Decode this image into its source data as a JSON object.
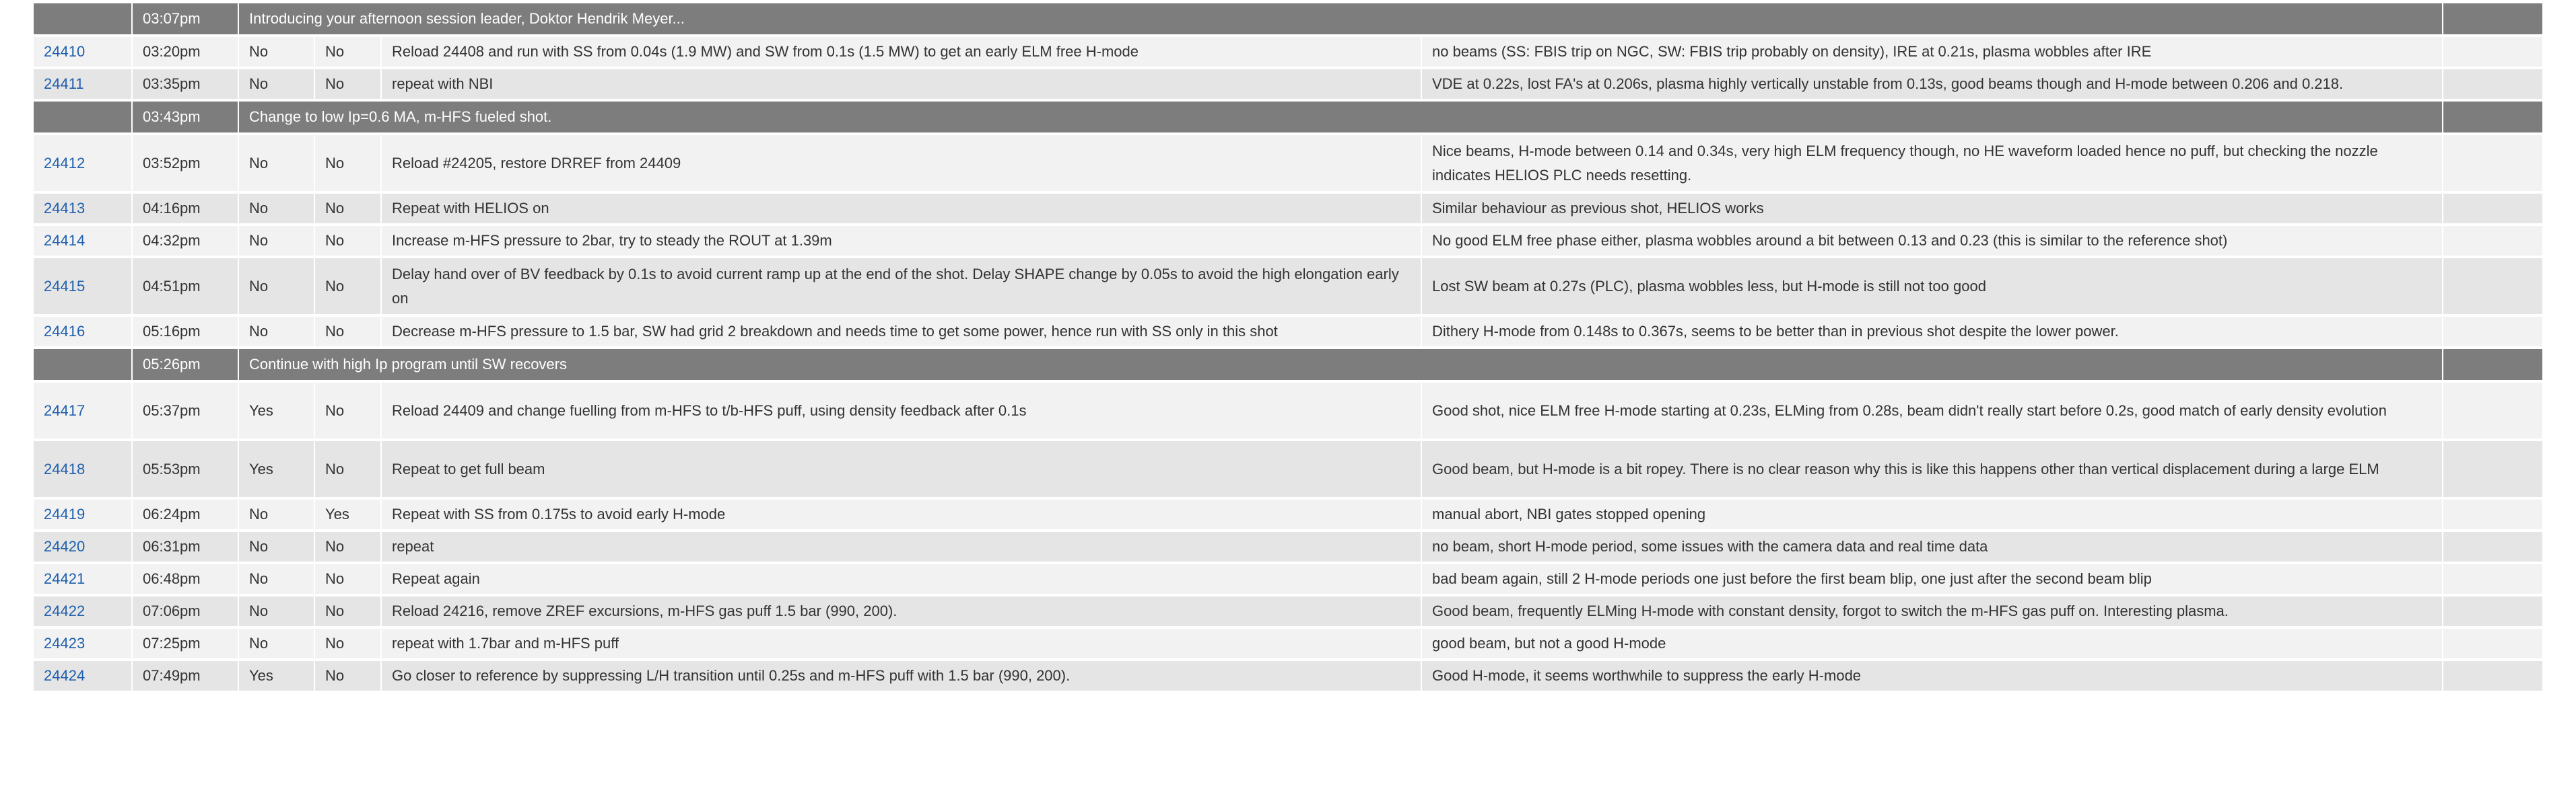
{
  "log": {
    "rows": [
      {
        "kind": "section",
        "time": "03:07pm",
        "text": "Introducing your afternoon session leader, Doktor Hendrik Meyer..."
      },
      {
        "kind": "shot",
        "shot": "24410",
        "time": "03:20pm",
        "col3": "No",
        "col4": "No",
        "description": "Reload 24408 and run with SS from 0.04s (1.9 MW) and SW from 0.1s (1.5 MW) to get an early ELM free H-mode",
        "result": "no beams (SS: FBIS trip on NGC, SW: FBIS trip probably on density), IRE at 0.21s, plasma wobbles after IRE"
      },
      {
        "kind": "shot",
        "shot": "24411",
        "time": "03:35pm",
        "col3": "No",
        "col4": "No",
        "description": "repeat with NBI",
        "result": "VDE at 0.22s, lost FA's at 0.206s, plasma highly vertically unstable from 0.13s, good beams though and H-mode between 0.206 and 0.218."
      },
      {
        "kind": "section",
        "time": "03:43pm",
        "text": "Change to low Ip=0.6 MA, m-HFS fueled shot."
      },
      {
        "kind": "shot",
        "shot": "24412",
        "time": "03:52pm",
        "col3": "No",
        "col4": "No",
        "description": "Reload #24205, restore DRREF from 24409",
        "result": "Nice beams, H-mode between 0.14 and 0.34s, very high ELM frequency though, no HE waveform loaded hence no puff, but checking the nozzle indicates HELIOS PLC needs resetting."
      },
      {
        "kind": "shot",
        "shot": "24413",
        "time": "04:16pm",
        "col3": "No",
        "col4": "No",
        "description": "Repeat with HELIOS on",
        "result": "Similar behaviour as previous shot, HELIOS works"
      },
      {
        "kind": "shot",
        "shot": "24414",
        "time": "04:32pm",
        "col3": "No",
        "col4": "No",
        "description": "Increase m-HFS pressure to 2bar, try to steady the ROUT at 1.39m",
        "result": "No good ELM free phase either, plasma wobbles around a bit between 0.13 and 0.23 (this is similar to the reference shot)"
      },
      {
        "kind": "shot",
        "shot": "24415",
        "time": "04:51pm",
        "col3": "No",
        "col4": "No",
        "description": "Delay hand over of BV feedback by 0.1s to avoid current ramp up at the end of the shot. Delay SHAPE change by 0.05s to avoid the high elongation early on",
        "result": "Lost SW beam at 0.27s (PLC), plasma wobbles less, but H-mode is still not too good"
      },
      {
        "kind": "shot",
        "shot": "24416",
        "time": "05:16pm",
        "col3": "No",
        "col4": "No",
        "description": "Decrease m-HFS pressure to 1.5 bar, SW had grid 2 breakdown and needs time to get some power, hence run with SS only in this shot",
        "result": "Dithery H-mode from 0.148s to 0.367s, seems to be better than in previous shot despite the lower power."
      },
      {
        "kind": "section",
        "time": "05:26pm",
        "text": "Continue with high Ip program until SW recovers"
      },
      {
        "kind": "shot",
        "shot": "24417",
        "time": "05:37pm",
        "col3": "Yes",
        "col4": "No",
        "description": "Reload 24409 and change fuelling from m-HFS to t/b-HFS puff, using density feedback after 0.1s",
        "result": "Good shot, nice ELM free H-mode starting at 0.23s, ELMing from 0.28s, beam didn't really start before 0.2s, good match of early density evolution"
      },
      {
        "kind": "shot",
        "shot": "24418",
        "time": "05:53pm",
        "col3": "Yes",
        "col4": "No",
        "description": "Repeat to get full beam",
        "result": "Good beam, but H-mode is a bit ropey. There is no clear reason why this is like this happens other than vertical displacement during a large ELM"
      },
      {
        "kind": "shot",
        "shot": "24419",
        "time": "06:24pm",
        "col3": "No",
        "col4": "Yes",
        "description": "Repeat with SS from 0.175s to avoid early H-mode",
        "result": "manual abort, NBI gates stopped opening"
      },
      {
        "kind": "shot",
        "shot": "24420",
        "time": "06:31pm",
        "col3": "No",
        "col4": "No",
        "description": "repeat",
        "result": "no beam, short H-mode period, some issues with the camera data and real time data"
      },
      {
        "kind": "shot",
        "shot": "24421",
        "time": "06:48pm",
        "col3": "No",
        "col4": "No",
        "description": "Repeat again",
        "result": "bad beam again, still 2 H-mode periods one just before the first beam blip, one just after the second beam blip"
      },
      {
        "kind": "shot",
        "shot": "24422",
        "time": "07:06pm",
        "col3": "No",
        "col4": "No",
        "description": "Reload 24216, remove ZREF excursions, m-HFS gas puff 1.5 bar (990, 200).",
        "result": "Good beam, frequently ELMing H-mode with constant density, forgot to switch the m-HFS gas puff on. Interesting plasma."
      },
      {
        "kind": "shot",
        "shot": "24423",
        "time": "07:25pm",
        "col3": "No",
        "col4": "No",
        "description": "repeat with 1.7bar and m-HFS puff",
        "result": "good beam, but not a good H-mode"
      },
      {
        "kind": "shot",
        "shot": "24424",
        "time": "07:49pm",
        "col3": "Yes",
        "col4": "No",
        "description": "Go closer to reference by suppressing L/H transition until 0.25s and m-HFS puff with 1.5 bar (990, 200).",
        "result": "Good H-mode, it seems worthwhile to suppress the early H-mode"
      }
    ]
  }
}
